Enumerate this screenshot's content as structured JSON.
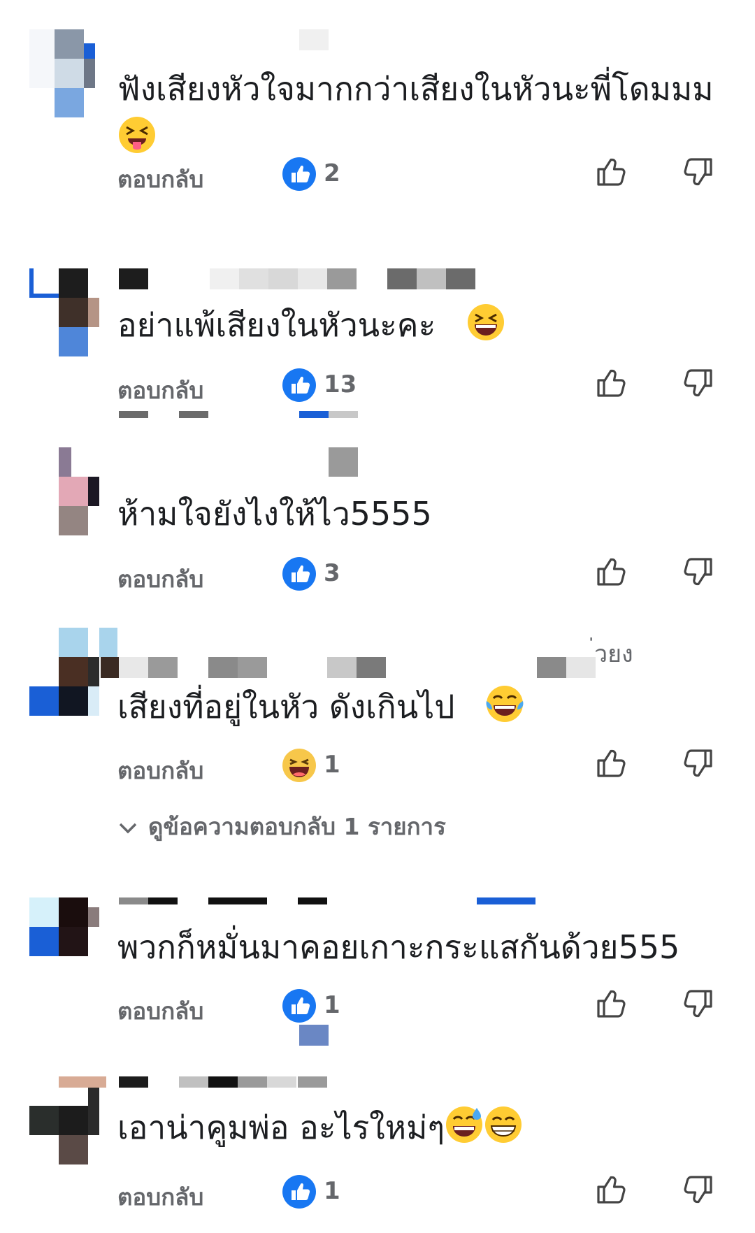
{
  "comments": [
    {
      "text": "ฟังเสียงหัวใจมากกว่าเสียงในหัวนะพี่โดมมม",
      "emoji": "squinting-tongue-face",
      "reply_label": "ตอบกลับ",
      "reaction_icon": "like-reaction-icon",
      "reaction_count": "2"
    },
    {
      "text": "อย่าแพ้เสียงในหัวนะคะ",
      "emoji": "grinning-squinting-face",
      "reply_label": "ตอบกลับ",
      "reaction_icon": "like-reaction-icon",
      "reaction_count": "13"
    },
    {
      "text": "ห้ามใจยังไงให้ไว5555",
      "reply_label": "ตอบกลับ",
      "reaction_icon": "like-reaction-icon",
      "reaction_count": "3"
    },
    {
      "name_fragment": "่วยง",
      "text": "เสียงที่อยู่ในหัว ดังเกินไป",
      "emoji": "face-with-tears-of-joy",
      "reply_label": "ตอบกลับ",
      "reaction_icon": "haha-reaction-icon",
      "reaction_count": "1",
      "view_replies": "ดูข้อความตอบกลับ 1 รายการ"
    },
    {
      "text": "พวกก็หมั่นมาคอยเกาะกระแสกันด้วย555",
      "reply_label": "ตอบกลับ",
      "reaction_icon": "like-reaction-icon",
      "reaction_count": "1"
    },
    {
      "text": "เอาน่าคูมพ่อ อะไรใหม่ๆ",
      "emoji": "grinning-face-with-sweat",
      "emoji2": "beaming-face-with-smiling-eyes",
      "reply_label": "ตอบกลับ",
      "reaction_icon": "like-reaction-icon",
      "reaction_count": "1"
    }
  ],
  "colors": {
    "like_blue": "#1877f2",
    "text_primary": "#1c1e21",
    "text_secondary": "#65676b"
  }
}
